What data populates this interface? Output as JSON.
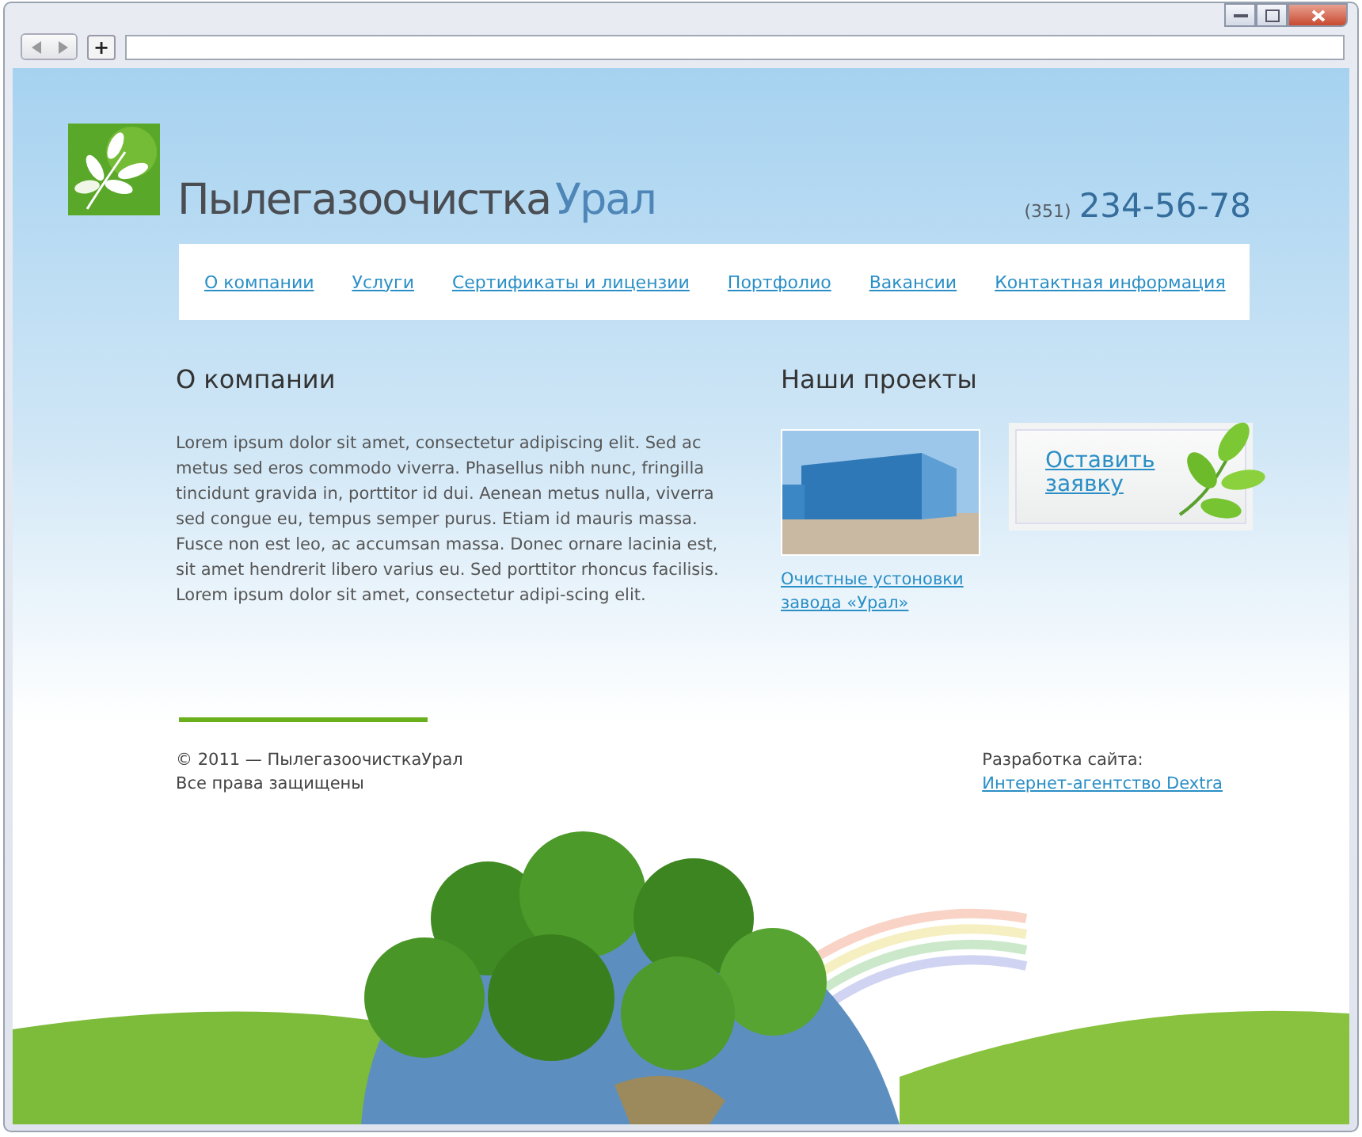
{
  "browser": {
    "new_tab": "+"
  },
  "header": {
    "logo_name": "Пылегазоочистка",
    "logo_region": "Урал",
    "phone_code": "(351)",
    "phone_number": "234-56-78"
  },
  "nav": [
    {
      "label": "О компании"
    },
    {
      "label": "Услуги"
    },
    {
      "label": "Сертификаты и лицензии"
    },
    {
      "label": "Портфолио"
    },
    {
      "label": "Вакансии"
    },
    {
      "label": "Контактная информация"
    }
  ],
  "about": {
    "title": "О компании",
    "text": "Lorem ipsum dolor sit amet, consectetur adipiscing elit. Sed ac metus sed eros commodo viverra. Phasellus nibh nunc, fringilla tincidunt gravida in, porttitor id dui. Aenean metus nulla, viverra sed congue eu, tempus semper purus. Etiam id mauris massa. Fusce non est leo, ac accumsan massa. Donec ornare lacinia est, sit amet hendrerit libero varius eu. Sed porttitor rhoncus facilisis. Lorem ipsum dolor sit amet, consectetur adipi-scing elit."
  },
  "projects": {
    "title": "Наши проекты",
    "project_caption": "Очистные устоновки завода «Урал»",
    "request_button": "Оставить заявку"
  },
  "footer": {
    "copyright": "© 2011 — ПылегазоочисткаУрал",
    "rights": "Все права защищены",
    "dev_label": "Разработка сайта:",
    "dev_link": "Интернет-агентство Dextra"
  }
}
